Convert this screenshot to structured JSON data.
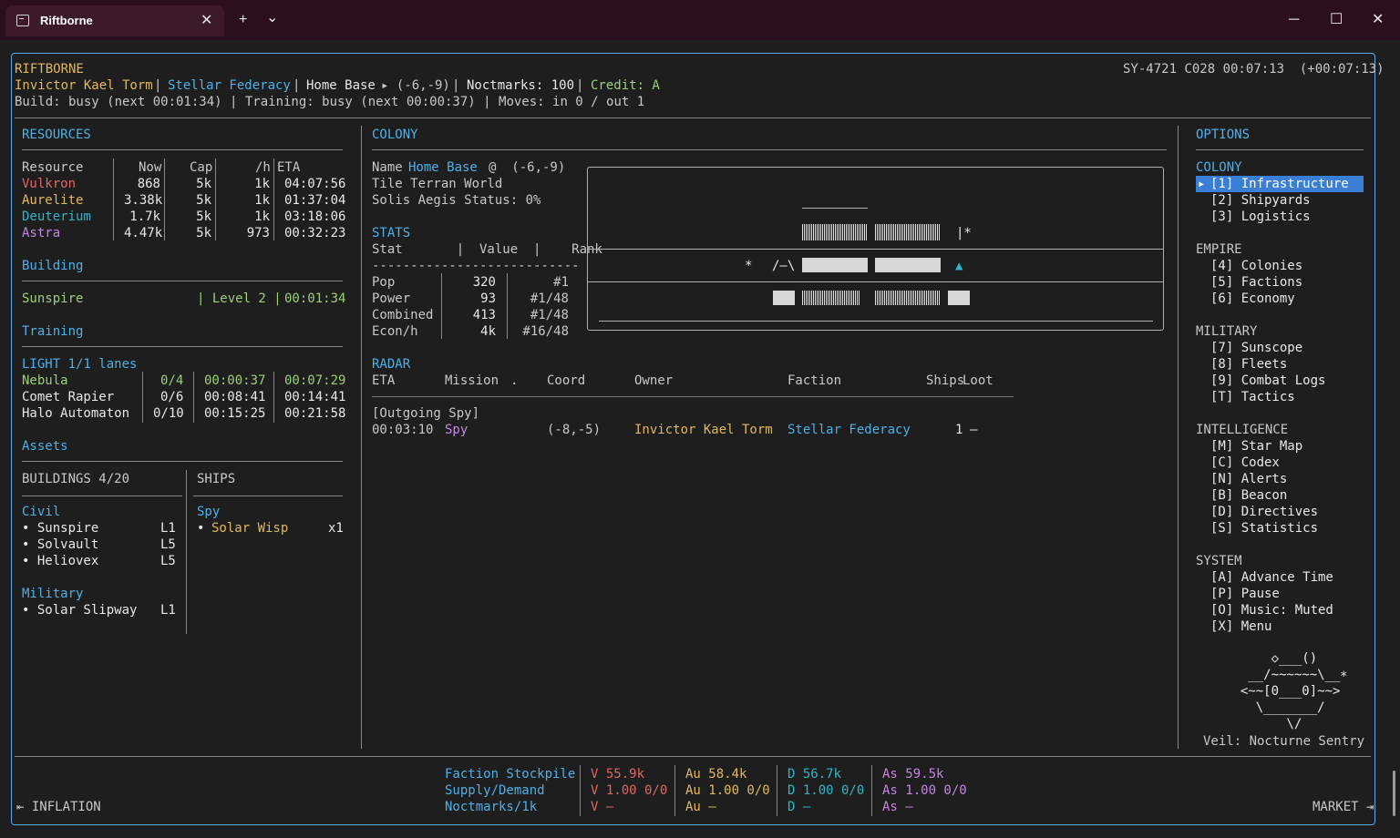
{
  "window": {
    "tab_title": "Riftborne",
    "new_tab": "+",
    "dropdown": "⌄",
    "minimize": "─",
    "maximize": "☐",
    "close": "✕",
    "tab_close": "✕"
  },
  "header": {
    "game_name": "RIFTBORNE",
    "player": "Invictor Kael Torm",
    "faction": "Stellar Federacy",
    "base_label": "Home Base",
    "base_coord": "▸ (-6,-9)",
    "noctmarks": "Noctmarks: 100",
    "credit": "Credit: A",
    "status_line": "Build: busy (next 00:01:34) | Training: busy (next 00:00:37) | Moves: in 0 / out 1",
    "clock": "SY-4721 C028 00:07:13  (+00:07:13)",
    "sep": "|"
  },
  "resources": {
    "title": "RESOURCES",
    "headers": [
      "Resource",
      "Now",
      "Cap",
      "/h",
      "ETA"
    ],
    "rows": [
      {
        "name": "Vulkron",
        "now": "868",
        "cap": "5k",
        "rate": "1k",
        "eta": "04:07:56",
        "color": "#e06666"
      },
      {
        "name": "Aurelite",
        "now": "3.38k",
        "cap": "5k",
        "rate": "1k",
        "eta": "01:37:04",
        "color": "#e0b860"
      },
      {
        "name": "Deuterium",
        "now": "1.7k",
        "cap": "5k",
        "rate": "1k",
        "eta": "03:18:06",
        "color": "#2fb5c7"
      },
      {
        "name": "Astra",
        "now": "4.47k",
        "cap": "5k",
        "rate": "973",
        "eta": "00:32:23",
        "color": "#c586e0"
      }
    ]
  },
  "building": {
    "title": "Building",
    "name": "Sunspire",
    "level": "| Level 2 |",
    "time": "00:01:34"
  },
  "training": {
    "title": "Training",
    "lanes": "LIGHT 1/1 lanes",
    "rows": [
      {
        "name": "Nebula",
        "count": "0/4",
        "t1": "00:00:37",
        "t2": "00:07:29",
        "active": true
      },
      {
        "name": "Comet Rapier",
        "count": "0/6",
        "t1": "00:08:41",
        "t2": "00:14:41",
        "active": false
      },
      {
        "name": "Halo Automaton",
        "count": "0/10",
        "t1": "00:15:25",
        "t2": "00:21:58",
        "active": false
      }
    ]
  },
  "assets": {
    "title": "Assets",
    "buildings_title": "BUILDINGS 4/20",
    "ships_title": "SHIPS",
    "civil_title": "Civil",
    "civil": [
      {
        "name": "• Sunspire",
        "lvl": "L1"
      },
      {
        "name": "• Solvault",
        "lvl": "L5"
      },
      {
        "name": "• Heliovex",
        "lvl": "L5"
      }
    ],
    "military_title": "Military",
    "military": [
      {
        "name": "• Solar Slipway",
        "lvl": "L1"
      }
    ],
    "ship_type": "Spy",
    "ship_bullet": "•",
    "ship_name": "Solar Wisp",
    "ship_count": "x1"
  },
  "colony": {
    "title": "COLONY",
    "name_label": "Name",
    "name_value": "Home Base",
    "name_coord": "@  (-6,-9)",
    "tile": "Tile Terran World",
    "aegis": "Solis Aegis Status: 0%",
    "stats_title": "STATS",
    "stats_header": "Stat       |  Value  |    Rank",
    "stats_rule": "---------------------------",
    "stats": [
      {
        "stat": "Pop",
        "value": "320",
        "rank": "#1"
      },
      {
        "stat": "Power",
        "value": "93",
        "rank": "#1/48"
      },
      {
        "stat": "Combined",
        "value": "413",
        "rank": "#1/48"
      },
      {
        "stat": "Econ/h",
        "value": "4k",
        "rank": "#16/48"
      }
    ],
    "map_glyphs": {
      "star": "*",
      "roof": "/—\\",
      "flag": "▲",
      "flag2": "|*"
    }
  },
  "radar": {
    "title": "RADAR",
    "headers": {
      "eta": "ETA",
      "mission": "Mission",
      "dot": ".",
      "coord": "Coord",
      "owner": "Owner",
      "faction": "Faction",
      "ships": "Ships",
      "loot": "Loot"
    },
    "rule": "-------------------------------------------------------------------------------------",
    "group": "[Outgoing Spy]",
    "rows": [
      {
        "eta": "00:03:10",
        "mission": "Spy",
        "coord": "(-8,-5)",
        "owner": "Invictor Kael Torm",
        "faction": "Stellar Federacy",
        "ships": "1",
        "loot": "–"
      }
    ]
  },
  "options": {
    "title": "OPTIONS",
    "groups": [
      {
        "title": "COLONY",
        "items": [
          "[1] Infrastructure",
          "[2] Shipyards",
          "[3] Logistics"
        ]
      },
      {
        "title": "EMPIRE",
        "items": [
          "[4] Colonies",
          "[5] Factions",
          "[6] Economy"
        ]
      },
      {
        "title": "MILITARY",
        "items": [
          "[7] Sunscope",
          "[8] Fleets",
          "[9] Combat Logs",
          "[T] Tactics"
        ]
      },
      {
        "title": "INTELLIGENCE",
        "items": [
          "[M] Star Map",
          "[C] Codex",
          "[N] Alerts",
          "[B] Beacon",
          "[D] Directives",
          "[S] Statistics"
        ]
      },
      {
        "title": "SYSTEM",
        "items": [
          "[A] Advance Time",
          "[P] Pause",
          "[O] Music: Muted",
          "[X] Menu"
        ]
      }
    ],
    "selected_marker": "▸",
    "veil": "Veil: Nocturne Sentry",
    "art": [
      "      ◇___()",
      "   __/~~~~~~\\__",
      "  <~~[0___0]~~>",
      "    \\_______/",
      "        \\/"
    ],
    "art_star": "*"
  },
  "footer": {
    "inflation": "⇤ INFLATION",
    "market": "MARKET ⇥",
    "labels": [
      "Faction Stockpile",
      "Supply/Demand",
      "Noctmarks/1k"
    ],
    "cols": [
      {
        "color": "#e06666",
        "lines": [
          "V 55.9k",
          "V 1.00 0/0",
          "V –"
        ]
      },
      {
        "color": "#e0b860",
        "lines": [
          "Au 58.4k",
          "Au 1.00 0/0",
          "Au –"
        ]
      },
      {
        "color": "#2fb5c7",
        "lines": [
          "D 56.7k",
          "D 1.00 0/0",
          "D –"
        ]
      },
      {
        "color": "#c586e0",
        "lines": [
          "As 59.5k",
          "As 1.00 0/0",
          "As –"
        ]
      }
    ]
  }
}
